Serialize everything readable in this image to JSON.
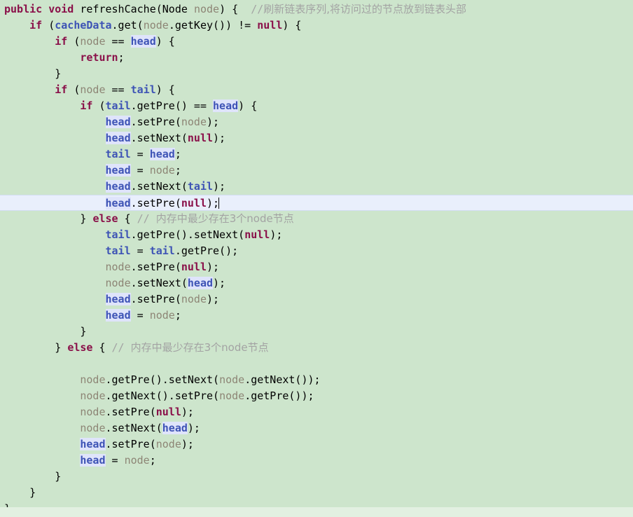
{
  "editor": {
    "language": "Java",
    "background_color": "#cde5cc",
    "current_line_color": "#e9effc",
    "occurrence_highlight_color": "#dfe4fb",
    "caret": "|",
    "colors": {
      "keyword": "#8a1049",
      "field": "#3d53b5",
      "parameter": "#8d8575",
      "literal": "#8a1049",
      "comment": "#a3a3a3",
      "plain": "#000000"
    }
  },
  "code": {
    "lines": [
      {
        "id": "line-1",
        "current": false,
        "tokens": [
          {
            "t": "kw",
            "v": "public"
          },
          {
            "t": "plain",
            "v": " "
          },
          {
            "t": "kw",
            "v": "void"
          },
          {
            "t": "plain",
            "v": " refreshCache("
          },
          {
            "t": "type",
            "v": "Node"
          },
          {
            "t": "plain",
            "v": " "
          },
          {
            "t": "param",
            "v": "node"
          },
          {
            "t": "plain",
            "v": ") {  "
          },
          {
            "t": "cmt",
            "v": "//"
          },
          {
            "t": "cmt-cn",
            "v": "刷新链表序列,将访问过的节点放到链表头部"
          }
        ]
      },
      {
        "id": "line-2",
        "current": false,
        "tokens": [
          {
            "t": "plain",
            "v": "    "
          },
          {
            "t": "kw",
            "v": "if"
          },
          {
            "t": "plain",
            "v": " ("
          },
          {
            "t": "fld",
            "v": "cacheData"
          },
          {
            "t": "plain",
            "v": ".get("
          },
          {
            "t": "param",
            "v": "node"
          },
          {
            "t": "plain",
            "v": ".getKey()) != "
          },
          {
            "t": "lit",
            "v": "null"
          },
          {
            "t": "plain",
            "v": ") {"
          }
        ]
      },
      {
        "id": "line-3",
        "current": false,
        "tokens": [
          {
            "t": "plain",
            "v": "        "
          },
          {
            "t": "kw",
            "v": "if"
          },
          {
            "t": "plain",
            "v": " ("
          },
          {
            "t": "param",
            "v": "node"
          },
          {
            "t": "plain",
            "v": " == "
          },
          {
            "t": "fldhl",
            "v": "head"
          },
          {
            "t": "plain",
            "v": ") {"
          }
        ]
      },
      {
        "id": "line-4",
        "current": false,
        "tokens": [
          {
            "t": "plain",
            "v": "            "
          },
          {
            "t": "kw",
            "v": "return"
          },
          {
            "t": "plain",
            "v": ";"
          }
        ]
      },
      {
        "id": "line-5",
        "current": false,
        "tokens": [
          {
            "t": "plain",
            "v": "        }"
          }
        ]
      },
      {
        "id": "line-6",
        "current": false,
        "tokens": [
          {
            "t": "plain",
            "v": "        "
          },
          {
            "t": "kw",
            "v": "if"
          },
          {
            "t": "plain",
            "v": " ("
          },
          {
            "t": "param",
            "v": "node"
          },
          {
            "t": "plain",
            "v": " == "
          },
          {
            "t": "fld",
            "v": "tail"
          },
          {
            "t": "plain",
            "v": ") {"
          }
        ]
      },
      {
        "id": "line-7",
        "current": false,
        "tokens": [
          {
            "t": "plain",
            "v": "            "
          },
          {
            "t": "kw",
            "v": "if"
          },
          {
            "t": "plain",
            "v": " ("
          },
          {
            "t": "fld",
            "v": "tail"
          },
          {
            "t": "plain",
            "v": ".getPre() == "
          },
          {
            "t": "fldhl",
            "v": "head"
          },
          {
            "t": "plain",
            "v": ") {"
          }
        ]
      },
      {
        "id": "line-8",
        "current": false,
        "tokens": [
          {
            "t": "plain",
            "v": "                "
          },
          {
            "t": "fldhl",
            "v": "head"
          },
          {
            "t": "plain",
            "v": ".setPre("
          },
          {
            "t": "param",
            "v": "node"
          },
          {
            "t": "plain",
            "v": ");"
          }
        ]
      },
      {
        "id": "line-9",
        "current": false,
        "tokens": [
          {
            "t": "plain",
            "v": "                "
          },
          {
            "t": "fldhl",
            "v": "head"
          },
          {
            "t": "plain",
            "v": ".setNext("
          },
          {
            "t": "lit",
            "v": "null"
          },
          {
            "t": "plain",
            "v": ");"
          }
        ]
      },
      {
        "id": "line-10",
        "current": false,
        "tokens": [
          {
            "t": "plain",
            "v": "                "
          },
          {
            "t": "fld",
            "v": "tail"
          },
          {
            "t": "plain",
            "v": " = "
          },
          {
            "t": "fldhl",
            "v": "head"
          },
          {
            "t": "plain",
            "v": ";"
          }
        ]
      },
      {
        "id": "line-11",
        "current": false,
        "tokens": [
          {
            "t": "plain",
            "v": "                "
          },
          {
            "t": "fldhl",
            "v": "head"
          },
          {
            "t": "plain",
            "v": " = "
          },
          {
            "t": "param",
            "v": "node"
          },
          {
            "t": "plain",
            "v": ";"
          }
        ]
      },
      {
        "id": "line-12",
        "current": false,
        "tokens": [
          {
            "t": "plain",
            "v": "                "
          },
          {
            "t": "fldhl",
            "v": "head"
          },
          {
            "t": "plain",
            "v": ".setNext("
          },
          {
            "t": "fld",
            "v": "tail"
          },
          {
            "t": "plain",
            "v": ");"
          }
        ]
      },
      {
        "id": "line-13",
        "current": true,
        "tokens": [
          {
            "t": "plain",
            "v": "                "
          },
          {
            "t": "fldhl",
            "v": "head"
          },
          {
            "t": "plain",
            "v": ".setPre("
          },
          {
            "t": "lit",
            "v": "null"
          },
          {
            "t": "plain",
            "v": ");"
          },
          {
            "t": "caret",
            "v": ""
          }
        ]
      },
      {
        "id": "line-14",
        "current": false,
        "tokens": [
          {
            "t": "plain",
            "v": "            } "
          },
          {
            "t": "kw",
            "v": "else"
          },
          {
            "t": "plain",
            "v": " { "
          },
          {
            "t": "cmt",
            "v": "// "
          },
          {
            "t": "cmt-cn",
            "v": "内存中最少存在3个node节点"
          }
        ]
      },
      {
        "id": "line-15",
        "current": false,
        "tokens": [
          {
            "t": "plain",
            "v": "                "
          },
          {
            "t": "fld",
            "v": "tail"
          },
          {
            "t": "plain",
            "v": ".getPre().setNext("
          },
          {
            "t": "lit",
            "v": "null"
          },
          {
            "t": "plain",
            "v": ");"
          }
        ]
      },
      {
        "id": "line-16",
        "current": false,
        "tokens": [
          {
            "t": "plain",
            "v": "                "
          },
          {
            "t": "fld",
            "v": "tail"
          },
          {
            "t": "plain",
            "v": " = "
          },
          {
            "t": "fld",
            "v": "tail"
          },
          {
            "t": "plain",
            "v": ".getPre();"
          }
        ]
      },
      {
        "id": "line-17",
        "current": false,
        "tokens": [
          {
            "t": "plain",
            "v": "                "
          },
          {
            "t": "param",
            "v": "node"
          },
          {
            "t": "plain",
            "v": ".setPre("
          },
          {
            "t": "lit",
            "v": "null"
          },
          {
            "t": "plain",
            "v": ");"
          }
        ]
      },
      {
        "id": "line-18",
        "current": false,
        "tokens": [
          {
            "t": "plain",
            "v": "                "
          },
          {
            "t": "param",
            "v": "node"
          },
          {
            "t": "plain",
            "v": ".setNext("
          },
          {
            "t": "fldhl",
            "v": "head"
          },
          {
            "t": "plain",
            "v": ");"
          }
        ]
      },
      {
        "id": "line-19",
        "current": false,
        "tokens": [
          {
            "t": "plain",
            "v": "                "
          },
          {
            "t": "fldhl",
            "v": "head"
          },
          {
            "t": "plain",
            "v": ".setPre("
          },
          {
            "t": "param",
            "v": "node"
          },
          {
            "t": "plain",
            "v": ");"
          }
        ]
      },
      {
        "id": "line-20",
        "current": false,
        "tokens": [
          {
            "t": "plain",
            "v": "                "
          },
          {
            "t": "fldhl",
            "v": "head"
          },
          {
            "t": "plain",
            "v": " = "
          },
          {
            "t": "param",
            "v": "node"
          },
          {
            "t": "plain",
            "v": ";"
          }
        ]
      },
      {
        "id": "line-21",
        "current": false,
        "tokens": [
          {
            "t": "plain",
            "v": "            }"
          }
        ]
      },
      {
        "id": "line-22",
        "current": false,
        "tokens": [
          {
            "t": "plain",
            "v": "        } "
          },
          {
            "t": "kw",
            "v": "else"
          },
          {
            "t": "plain",
            "v": " { "
          },
          {
            "t": "cmt",
            "v": "// "
          },
          {
            "t": "cmt-cn",
            "v": "内存中最少存在3个node节点"
          }
        ]
      },
      {
        "id": "line-23",
        "current": false,
        "tokens": [
          {
            "t": "plain",
            "v": ""
          }
        ]
      },
      {
        "id": "line-24",
        "current": false,
        "tokens": [
          {
            "t": "plain",
            "v": "            "
          },
          {
            "t": "param",
            "v": "node"
          },
          {
            "t": "plain",
            "v": ".getPre().setNext("
          },
          {
            "t": "param",
            "v": "node"
          },
          {
            "t": "plain",
            "v": ".getNext());"
          }
        ]
      },
      {
        "id": "line-25",
        "current": false,
        "tokens": [
          {
            "t": "plain",
            "v": "            "
          },
          {
            "t": "param",
            "v": "node"
          },
          {
            "t": "plain",
            "v": ".getNext().setPre("
          },
          {
            "t": "param",
            "v": "node"
          },
          {
            "t": "plain",
            "v": ".getPre());"
          }
        ]
      },
      {
        "id": "line-26",
        "current": false,
        "tokens": [
          {
            "t": "plain",
            "v": "            "
          },
          {
            "t": "param",
            "v": "node"
          },
          {
            "t": "plain",
            "v": ".setPre("
          },
          {
            "t": "lit",
            "v": "null"
          },
          {
            "t": "plain",
            "v": ");"
          }
        ]
      },
      {
        "id": "line-27",
        "current": false,
        "tokens": [
          {
            "t": "plain",
            "v": "            "
          },
          {
            "t": "param",
            "v": "node"
          },
          {
            "t": "plain",
            "v": ".setNext("
          },
          {
            "t": "fldhl",
            "v": "head"
          },
          {
            "t": "plain",
            "v": ");"
          }
        ]
      },
      {
        "id": "line-28",
        "current": false,
        "tokens": [
          {
            "t": "plain",
            "v": "            "
          },
          {
            "t": "fldhl",
            "v": "head"
          },
          {
            "t": "plain",
            "v": ".setPre("
          },
          {
            "t": "param",
            "v": "node"
          },
          {
            "t": "plain",
            "v": ");"
          }
        ]
      },
      {
        "id": "line-29",
        "current": false,
        "tokens": [
          {
            "t": "plain",
            "v": "            "
          },
          {
            "t": "fldhl",
            "v": "head"
          },
          {
            "t": "plain",
            "v": " = "
          },
          {
            "t": "param",
            "v": "node"
          },
          {
            "t": "plain",
            "v": ";"
          }
        ]
      },
      {
        "id": "line-30",
        "current": false,
        "tokens": [
          {
            "t": "plain",
            "v": "        }"
          }
        ]
      },
      {
        "id": "line-31",
        "current": false,
        "tokens": [
          {
            "t": "plain",
            "v": "    }"
          }
        ]
      },
      {
        "id": "line-32",
        "current": false,
        "tokens": [
          {
            "t": "plain",
            "v": "}"
          }
        ]
      }
    ]
  }
}
